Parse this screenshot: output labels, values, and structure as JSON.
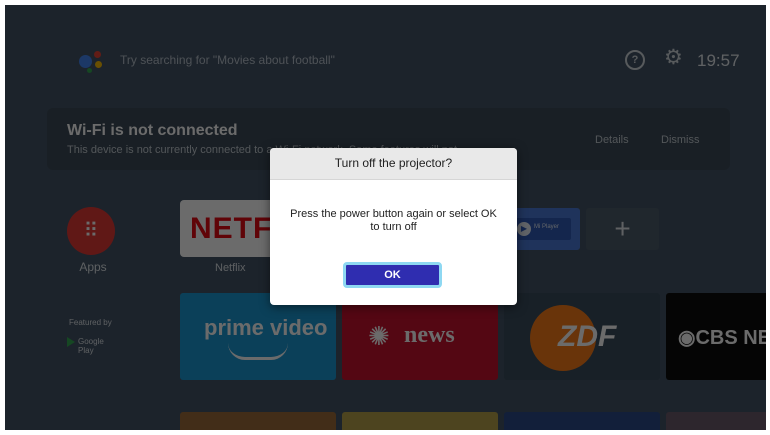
{
  "topbar": {
    "search_hint": "Try searching for \"Movies about football\"",
    "clock": "19:57",
    "help_glyph": "?",
    "settings_icon": "gear-icon"
  },
  "notification": {
    "title": "Wi-Fi is not connected",
    "body": "This device is not currently connected to a Wi-Fi network. Some features will not...",
    "details_label": "Details",
    "dismiss_label": "Dismiss"
  },
  "apps_row": {
    "apps_label": "Apps",
    "netflix_logo": "NETFLIX",
    "netflix_label": "Netflix",
    "miplayer_text": "Mi Player"
  },
  "featured_row": {
    "featured_label": "Featured by",
    "google_play": "Google Play",
    "prime_text": "prime video",
    "cbc_text": "news",
    "zdf_text": "ZDF",
    "cbs_text": "◉CBS NEWS"
  },
  "dialog": {
    "title": "Turn off the projector?",
    "message": "Press the power button again or select OK to turn off",
    "ok_label": "OK"
  },
  "colors": {
    "dialog_button": "#2f2db0",
    "focus_ring": "#8ed8f2",
    "apps_red": "#e53935",
    "netflix_red": "#e50914",
    "prime_blue": "#1a98d5",
    "cbc_red": "#c8102e",
    "zdf_orange": "#fa7d19"
  }
}
